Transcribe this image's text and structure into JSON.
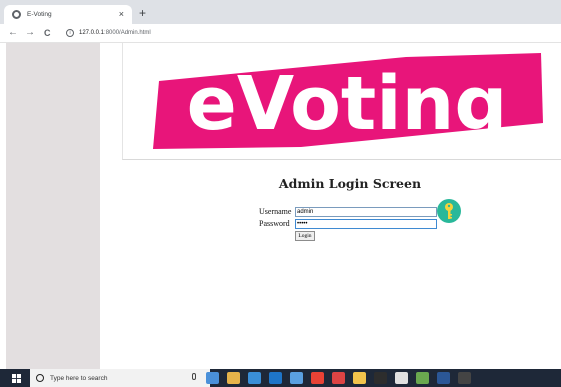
{
  "browser": {
    "tab_title": "E-Voting",
    "tab_close": "×",
    "new_tab": "+",
    "back": "←",
    "forward": "→",
    "reload": "C",
    "info": "i",
    "url_host": "127.0.0.1",
    "url_path": ":8000/Admin.html"
  },
  "banner": {
    "logo_text": "eVoting",
    "logo_color": "#e8157a"
  },
  "login": {
    "title": "Admin Login Screen",
    "username_label": "Username",
    "username_value": "admin",
    "password_label": "Password",
    "password_value": "•••••",
    "login_button": "Login"
  },
  "taskbar": {
    "search_placeholder": "Type here to search",
    "icons": [
      "task-view-icon",
      "edge-icon",
      "store-icon",
      "ie-icon",
      "photos-icon",
      "chrome-icon",
      "app-icon",
      "explorer-icon",
      "terminal-icon",
      "python-icon",
      "paint-icon",
      "word-icon",
      "cmd-icon"
    ],
    "icon_colors": [
      "#4a90d9",
      "#e6b34a",
      "#3a8fd8",
      "#1e75c8",
      "#5aa0e0",
      "#e94235",
      "#d44",
      "#f2c44c",
      "#2d2d2d",
      "#e0e0e0",
      "#6aa84f",
      "#2b5797",
      "#444"
    ]
  }
}
